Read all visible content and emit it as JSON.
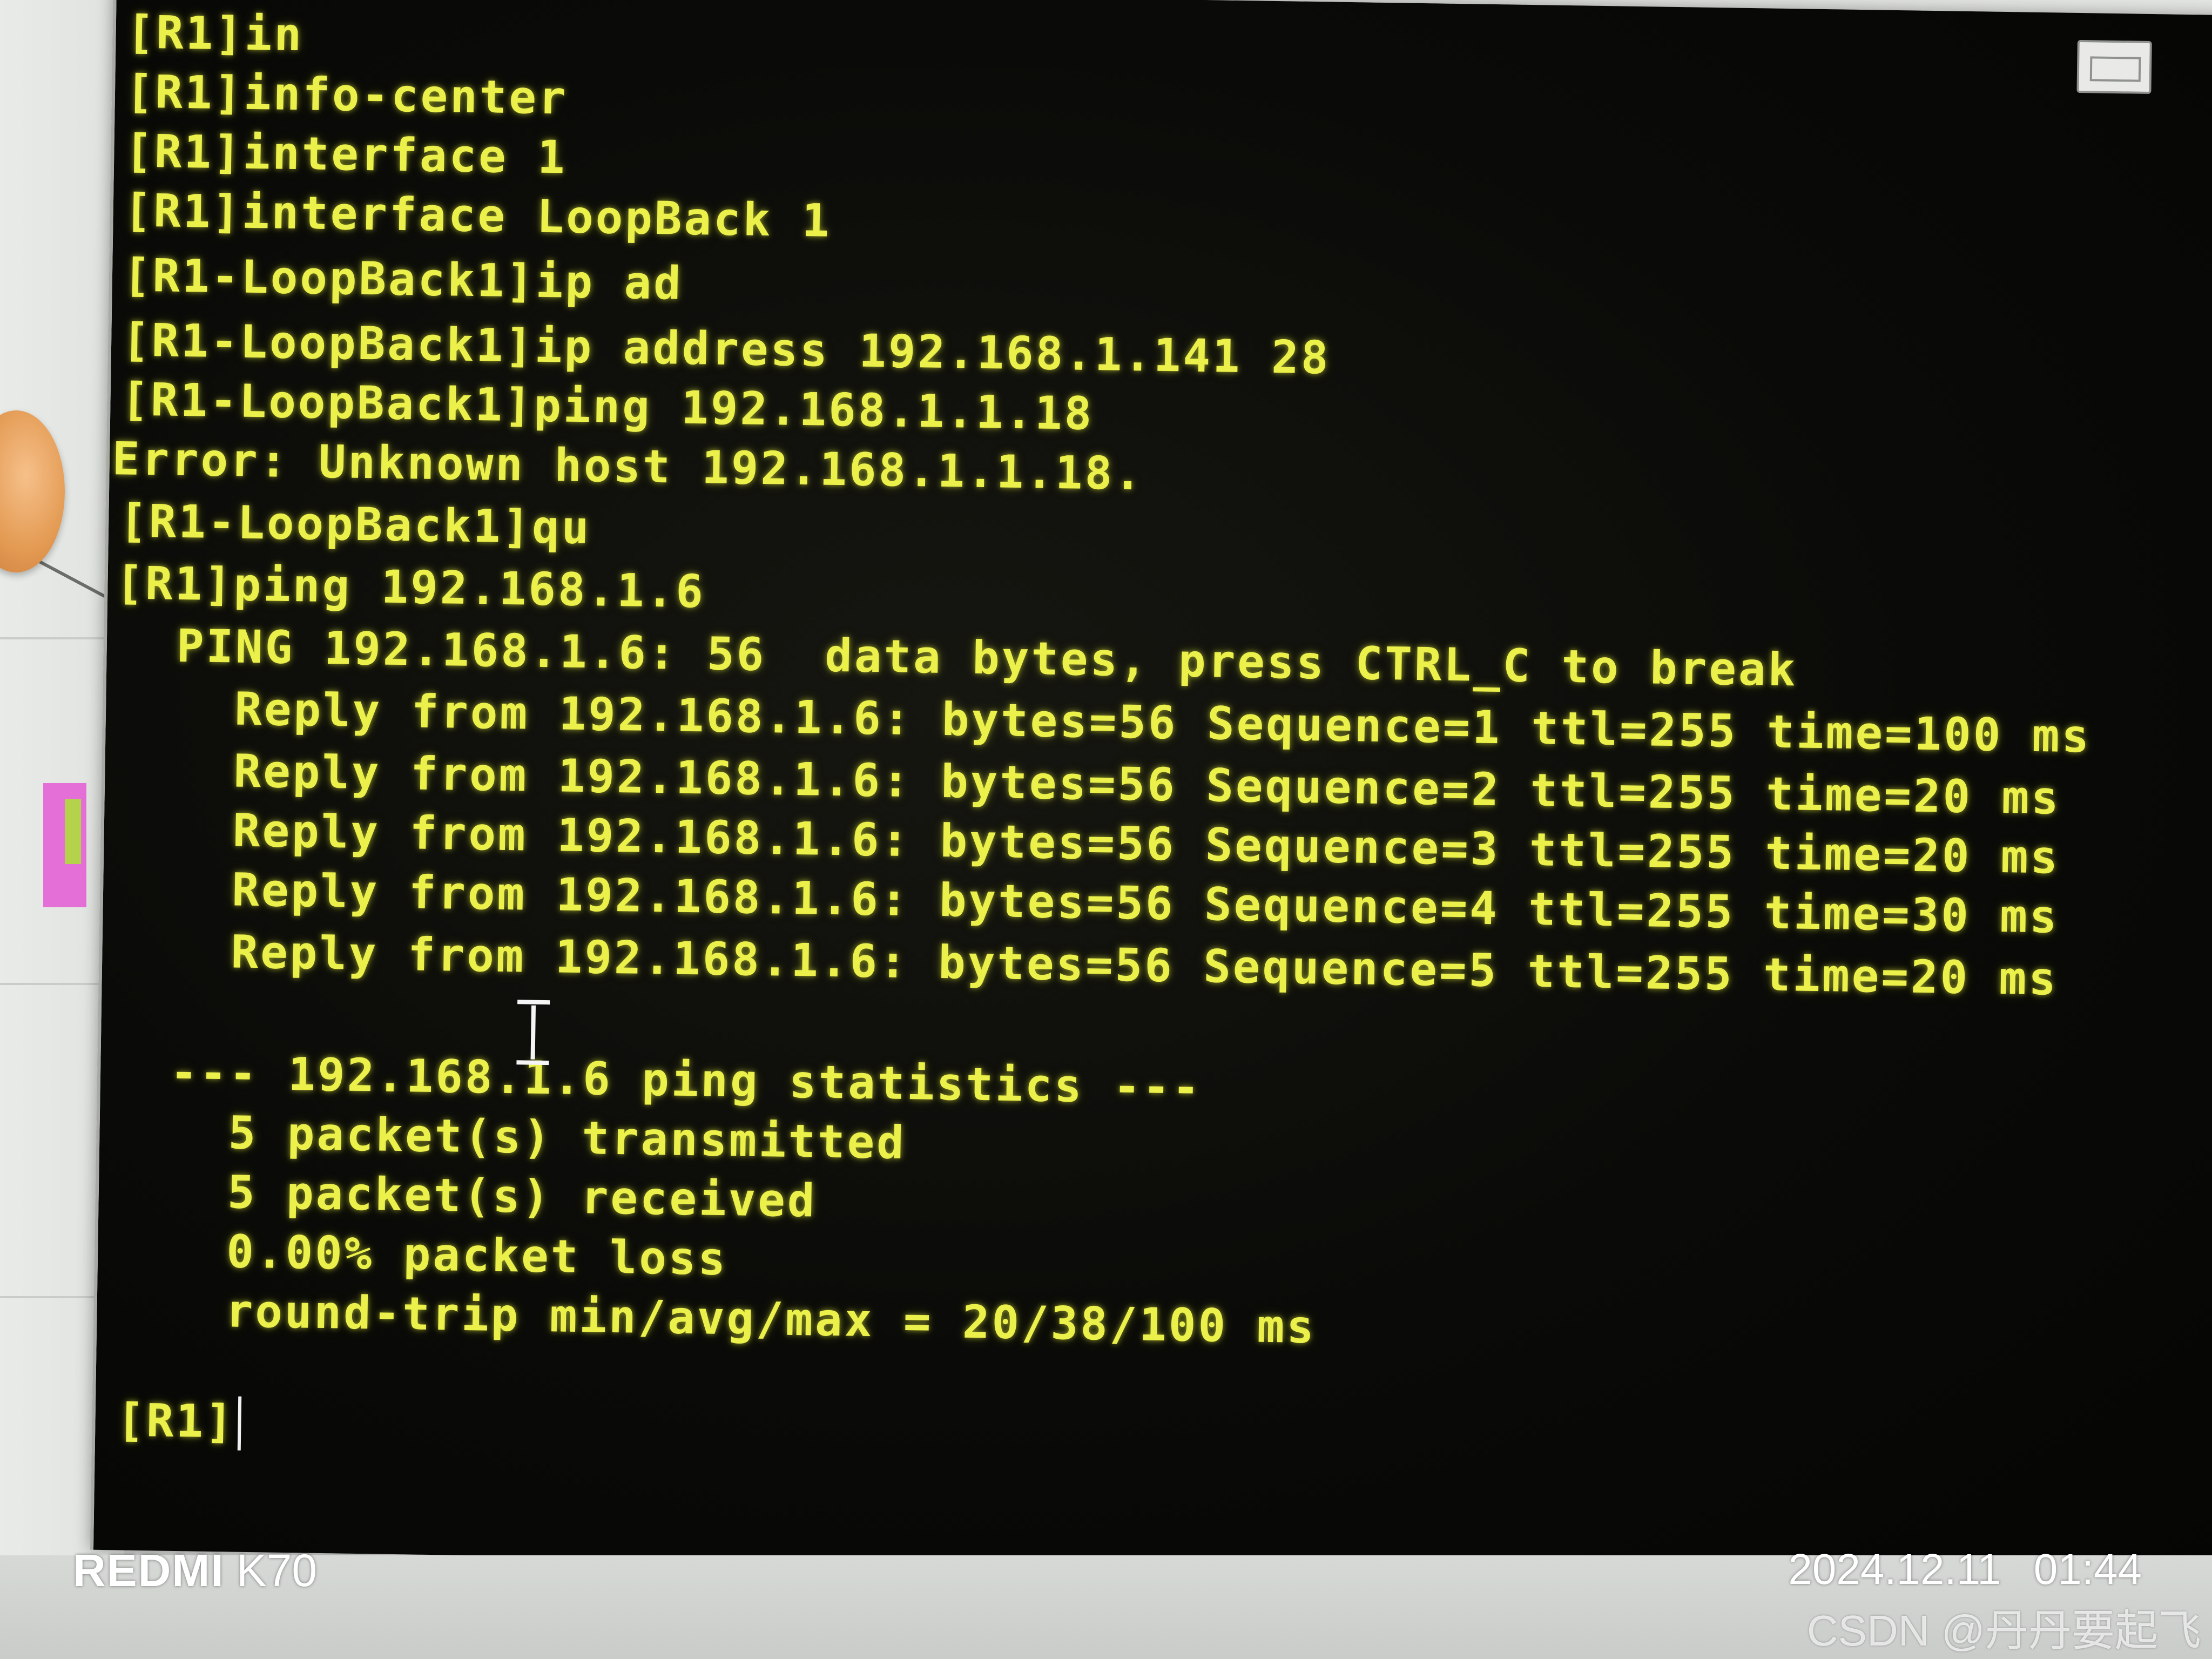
{
  "terminal": {
    "lines": [
      "[R1]in",
      "[R1]info-center",
      "[R1]interface 1",
      "[R1]interface LoopBack 1",
      "[R1-LoopBack1]ip ad",
      "[R1-LoopBack1]ip address 192.168.1.141 28",
      "[R1-LoopBack1]ping 192.168.1.1.18",
      "Error: Unknown host 192.168.1.1.18.",
      "[R1-LoopBack1]qu",
      "[R1]ping 192.168.1.6",
      "  PING 192.168.1.6: 56  data bytes, press CTRL_C to break",
      "    Reply from 192.168.1.6: bytes=56 Sequence=1 ttl=255 time=100 ms",
      "    Reply from 192.168.1.6: bytes=56 Sequence=2 ttl=255 time=20 ms",
      "    Reply from 192.168.1.6: bytes=56 Sequence=3 ttl=255 time=20 ms",
      "    Reply from 192.168.1.6: bytes=56 Sequence=4 ttl=255 time=30 ms",
      "    Reply from 192.168.1.6: bytes=56 Sequence=5 ttl=255 time=20 ms",
      "  --- 192.168.1.6 ping statistics ---",
      "    5 packet(s) transmitted",
      "    5 packet(s) received",
      "    0.00% packet loss",
      "    round-trip min/avg/max = 20/38/100 ms",
      "[R1]"
    ],
    "text_color": "#ecf04a",
    "background_color": "#0a0a08"
  },
  "watermark": {
    "brand": "REDMI",
    "model": "K70",
    "date": "2024.12.11",
    "time": "01:44",
    "source": "CSDN @丹丹要起飞"
  },
  "icons": {
    "maximize": "maximize-icon",
    "cursor": "text-cursor-icon",
    "router": "router-icon"
  }
}
